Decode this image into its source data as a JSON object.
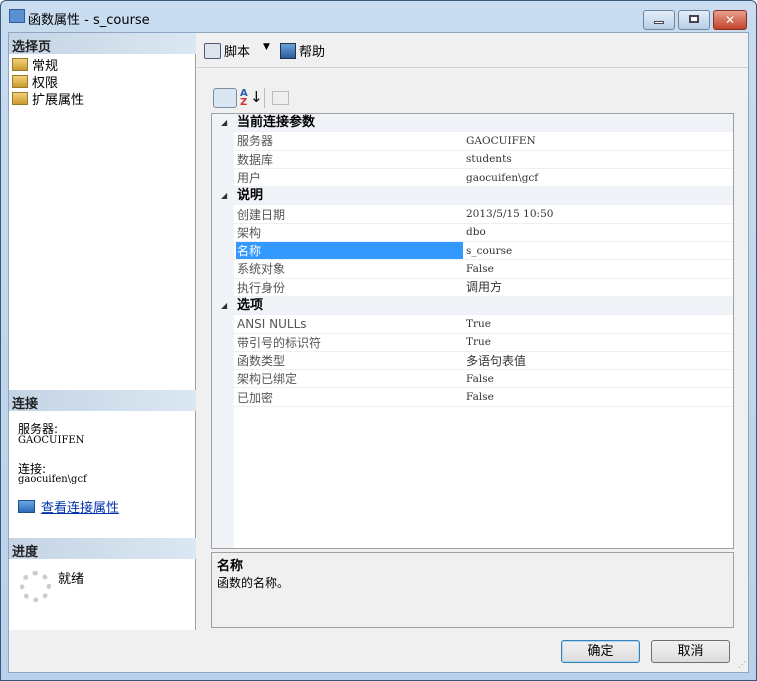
{
  "window": {
    "title": "函数属性 - s_course",
    "close_glyph": "✕"
  },
  "sidebar": {
    "select_page_header": "选择页",
    "pages": [
      {
        "label": "常规"
      },
      {
        "label": "权限"
      },
      {
        "label": "扩展属性"
      }
    ],
    "connection_header": "连接",
    "server_label": "服务器:",
    "server_value": "GAOCUIFEN",
    "connection_label": "连接:",
    "connection_value": "gaocuifen\\gcf",
    "view_connection_link": "查看连接属性",
    "progress_header": "进度",
    "progress_status": "就绪"
  },
  "toolbar": {
    "script_label": "脚本",
    "help_label": "帮助"
  },
  "grid": {
    "categories": [
      {
        "name": "当前连接参数",
        "rows": [
          {
            "k": "服务器",
            "v": "GAOCUIFEN"
          },
          {
            "k": "数据库",
            "v": "students"
          },
          {
            "k": "用户",
            "v": "gaocuifen\\gcf"
          }
        ]
      },
      {
        "name": "说明",
        "rows": [
          {
            "k": "创建日期",
            "v": "2013/5/15 10:50"
          },
          {
            "k": "架构",
            "v": "dbo"
          },
          {
            "k": "名称",
            "v": "s_course",
            "selected": true
          },
          {
            "k": "系统对象",
            "v": "False"
          },
          {
            "k": "执行身份",
            "v": "调用方",
            "cn": true
          }
        ]
      },
      {
        "name": "选项",
        "rows": [
          {
            "k": "ANSI NULLs",
            "v": "True"
          },
          {
            "k": "带引号的标识符",
            "v": "True"
          },
          {
            "k": "函数类型",
            "v": "多语句表值",
            "cn": true
          },
          {
            "k": "架构已绑定",
            "v": "False"
          },
          {
            "k": "已加密",
            "v": "False"
          }
        ]
      }
    ]
  },
  "description": {
    "title": "名称",
    "text": "函数的名称。"
  },
  "buttons": {
    "ok": "确定",
    "cancel": "取消"
  },
  "colors": {
    "selection": "#3399ff",
    "header": "#c5d5e5"
  }
}
